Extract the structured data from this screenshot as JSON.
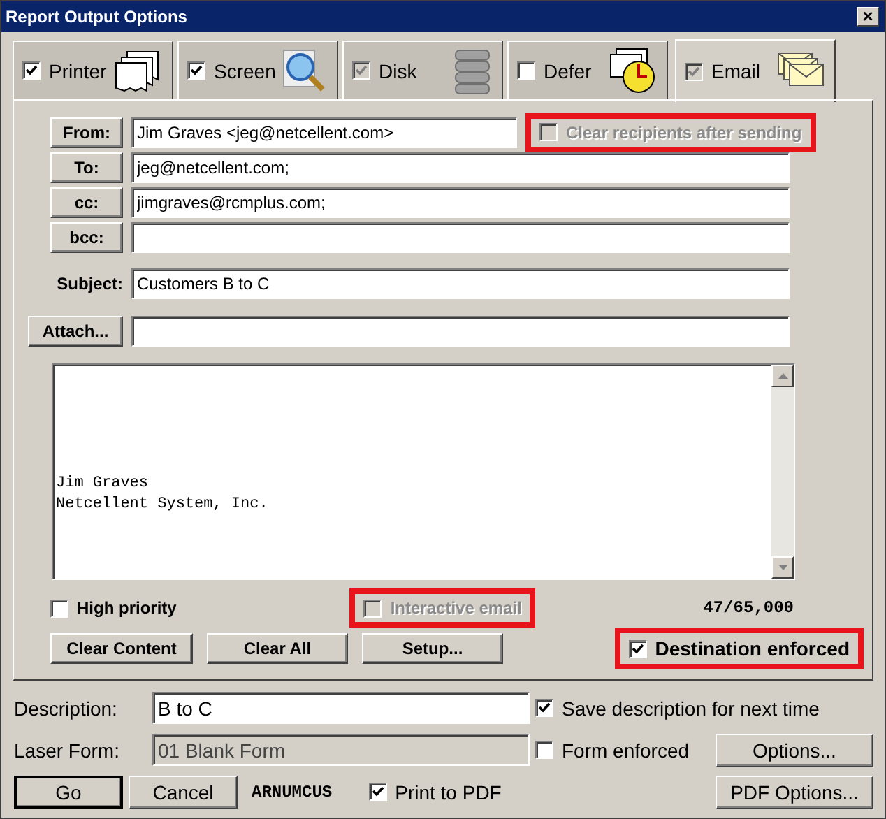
{
  "window": {
    "title": "Report Output Options",
    "close": "×"
  },
  "tabs": [
    {
      "label": "Printer",
      "kind": "printer",
      "checked": true,
      "disabled": false,
      "selected": false
    },
    {
      "label": "Screen",
      "kind": "screen",
      "checked": true,
      "disabled": false,
      "selected": false
    },
    {
      "label": "Disk",
      "kind": "disk",
      "checked": true,
      "disabled": true,
      "selected": false
    },
    {
      "label": "Defer",
      "kind": "defer",
      "checked": false,
      "disabled": false,
      "selected": false
    },
    {
      "label": "Email",
      "kind": "email",
      "checked": true,
      "disabled": true,
      "selected": true
    }
  ],
  "email": {
    "address_fields": [
      {
        "button": "From:",
        "value": "Jim Graves <jeg@netcellent.com>"
      },
      {
        "button": "To:",
        "value": "jeg@netcellent.com;"
      },
      {
        "button": "cc:",
        "value": "jimgraves@rcmplus.com;"
      },
      {
        "button": "bcc:"
      }
    ],
    "clear_recipients": {
      "label": "Clear recipients after sending",
      "checked": false,
      "disabled": true,
      "highlighted": true
    },
    "subject": {
      "label": "Subject:",
      "value": "Customers B to C"
    },
    "attach": {
      "button": "Attach..."
    },
    "body": [
      "Jim Graves",
      "Netcellent System, Inc."
    ],
    "high_priority": {
      "label": "High priority",
      "checked": false,
      "disabled": false,
      "highlighted": false
    },
    "interactive_email": {
      "label": "Interactive email",
      "checked": false,
      "disabled": true,
      "highlighted": true
    },
    "counter": "47/65,000",
    "buttons": [
      "Clear Content",
      "Clear All",
      "Setup..."
    ],
    "destination_enforced": {
      "label": "Destination enforced",
      "checked": true,
      "disabled": false,
      "highlighted": true
    }
  },
  "description": {
    "label": "Description:",
    "value": "B to C",
    "disabled": false
  },
  "save_description": {
    "label": "Save description for next time",
    "checked": true,
    "disabled": false,
    "highlighted": false
  },
  "laser_form": {
    "label": "Laser Form:",
    "value": "01 Blank Form",
    "disabled": true
  },
  "form_enforced": {
    "label": "Form enforced",
    "checked": false,
    "disabled": false,
    "highlighted": false
  },
  "options_button": "Options...",
  "actions": [
    {
      "label": "Go",
      "default": true
    },
    {
      "label": "Cancel",
      "default": false
    }
  ],
  "report_code": "ARNUMCUS",
  "print_to_pdf": {
    "label": "Print to PDF",
    "checked": true,
    "disabled": false,
    "highlighted": false
  },
  "pdf_options_button": "PDF Options..."
}
